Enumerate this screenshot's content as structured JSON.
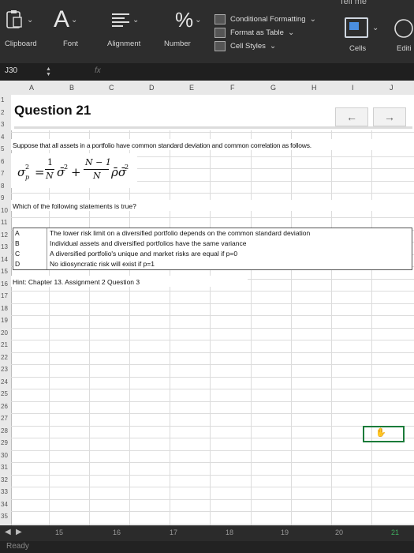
{
  "ribbon": {
    "tell_me": "Tell me",
    "groups": {
      "clipboard": "Clipboard",
      "font": "Font",
      "alignment": "Alignment",
      "number": "Number",
      "cells": "Cells",
      "editing": "Editi"
    },
    "font_glyph": "A",
    "number_glyph": "%",
    "styles": {
      "conditional_formatting": "Conditional Formatting",
      "format_as_table": "Format as Table",
      "cell_styles": "Cell Styles"
    }
  },
  "formula_bar": {
    "name_box": "J30",
    "fx": "fx"
  },
  "sheet": {
    "columns": [
      "A",
      "B",
      "C",
      "D",
      "E",
      "F",
      "G",
      "H",
      "I",
      "J"
    ],
    "rows": [
      "1",
      "2",
      "3",
      "4",
      "5",
      "6",
      "7",
      "8",
      "9",
      "10",
      "11",
      "12",
      "13",
      "14",
      "15",
      "16",
      "17",
      "18",
      "19",
      "20",
      "21",
      "22",
      "23",
      "24",
      "25",
      "26",
      "27",
      "28",
      "29",
      "30",
      "31",
      "32",
      "33",
      "34",
      "35"
    ],
    "question_title": "Question 21",
    "nav_prev": "←",
    "nav_next": "→",
    "intro": "Suppose that all assets in a portfolio have common standard deviation and common correlation as follows.",
    "formula": {
      "lhs": "σ",
      "lhs_sub": "p",
      "sup": "2",
      "eq": "=",
      "frac1_num": "1",
      "frac1_den": "N",
      "term1": "σ̄",
      "plus": "+",
      "frac2_num": "N − 1",
      "frac2_den": "N",
      "term2": "ρ̄σ̄"
    },
    "question": "Which of the following statements is true?",
    "options": [
      {
        "key": "A",
        "text": "The lower risk limit on a diversified portfolio depends on the common standard deviation"
      },
      {
        "key": "B",
        "text": "Individual assets and diversified portfolios have the same variance"
      },
      {
        "key": "C",
        "text": "A diversified portfolio's unique and market risks are equal if p=0"
      },
      {
        "key": "D",
        "text": "No idiosyncratic risk will exist if p=1"
      }
    ],
    "hint": "Hint: Chapter 13. Assignment 2 Question 3"
  },
  "tabs": {
    "numbers": [
      "15",
      "16",
      "17",
      "18",
      "19",
      "20",
      "21"
    ]
  },
  "status": {
    "text": "Ready"
  },
  "colors": {
    "ribbon_bg": "#2d2d2d",
    "sheet_bg": "#ffffff",
    "selection": "#1b7b3a",
    "tab_active": "#1b7b3a"
  }
}
